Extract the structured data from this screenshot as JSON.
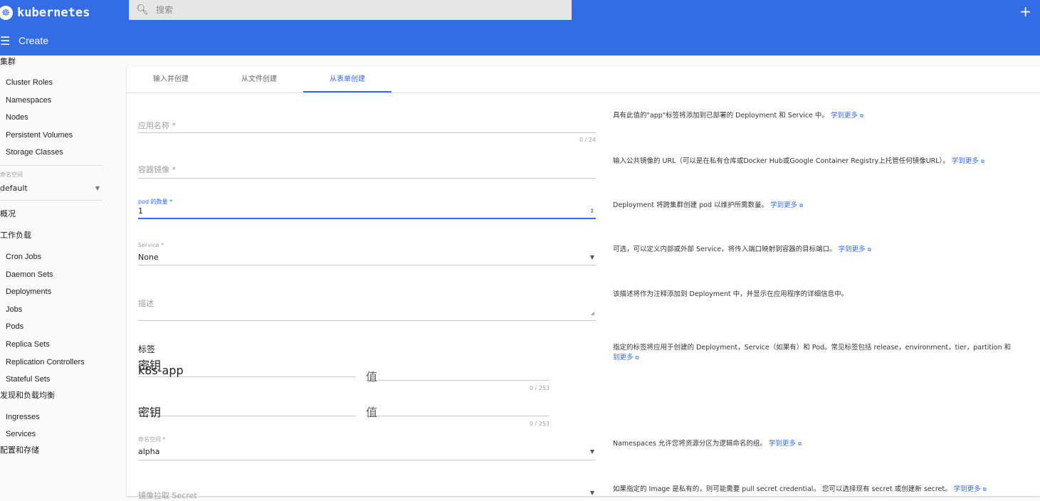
{
  "app": {
    "name": "kubernetes"
  },
  "search": {
    "placeholder": "搜索"
  },
  "header": {
    "title": "Create"
  },
  "sidebar": {
    "cluster_title": "集群",
    "cluster_items": [
      "Cluster Roles",
      "Namespaces",
      "Nodes",
      "Persistent Volumes",
      "Storage Classes"
    ],
    "namespace_label": "命名空间",
    "namespace_value": "default",
    "overview": "概况",
    "workloads_title": "工作负载",
    "workload_items": [
      "Cron Jobs",
      "Daemon Sets",
      "Deployments",
      "Jobs",
      "Pods",
      "Replica Sets",
      "Replication Controllers",
      "Stateful Sets"
    ],
    "discovery_title": "发现和负载均衡",
    "discovery_items": [
      "Ingresses",
      "Services"
    ],
    "config_title": "配置和存储"
  },
  "tabs": [
    "输入并创建",
    "从文件创建",
    "从表单创建"
  ],
  "form": {
    "app_name_placeholder": "应用名称 *",
    "app_name_counter": "0 / 24",
    "image_placeholder": "容器镜像 *",
    "pods_label": "pod 的数量 *",
    "pods_value": "1",
    "service_label": "Service *",
    "service_value": "None",
    "desc_placeholder": "描述",
    "labels_title": "标签",
    "key_label": "密钥",
    "key1_value": "k8s-app",
    "value_placeholder": "值",
    "key_counter": "0 / 253",
    "key2_placeholder": "密钥",
    "ns_label": "命名空间 *",
    "ns_value": "alpha",
    "secret_placeholder": "镜像拉取 Secret"
  },
  "help": {
    "learn_more": "学到更多",
    "app_name": "具有此值的\"app\"标签将添加到已部署的 Deployment 和 Service 中。",
    "image": "输入公共镜像的 URL（可以是在私有仓库或Docker Hub或Google Container Registry上托管任何镜像URL）。",
    "pods": "Deployment 将跨集群创建 pod 以维护所需数量。",
    "service": "可选，可以定义内部或外部 Service，将传入端口映射到容器的目标端口。",
    "desc": "该描述将作为注释添加到 Deployment 中，并显示在应用程序的详细信息中。",
    "labels": "指定的标签将应用于创建的 Deployment，Service（如果有）和 Pod。常见标签包括 release，environment，tier，partition 和",
    "labels_more": "到更多",
    "namespace": "Namespaces 允许您将资源分区为逻辑命名的组。",
    "secret": "如果指定的 Image 是私有的，则可能需要 pull secret credential。 您可以选择现有 secret 或创建新 secret。"
  }
}
